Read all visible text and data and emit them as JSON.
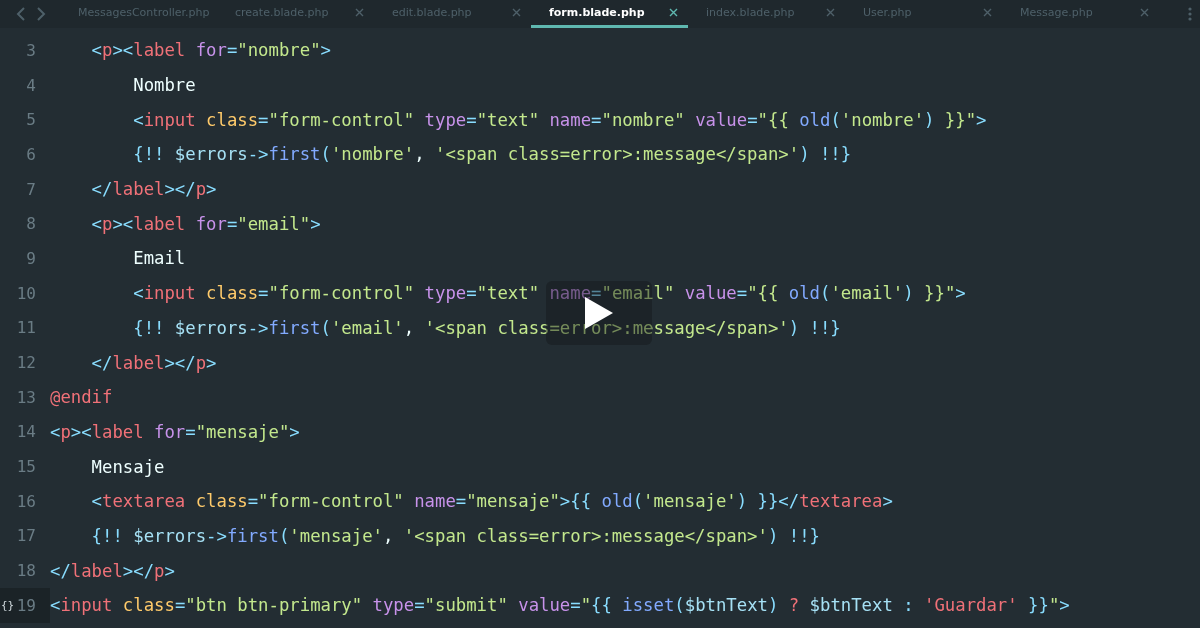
{
  "tabs": [
    {
      "label": "MessagesController.php",
      "selected": false
    },
    {
      "label": "create.blade.php",
      "selected": false
    },
    {
      "label": "edit.blade.php",
      "selected": false
    },
    {
      "label": "form.blade.php",
      "selected": true
    },
    {
      "label": "index.blade.php",
      "selected": false
    },
    {
      "label": "User.php",
      "selected": false
    },
    {
      "label": "Message.php",
      "selected": false
    }
  ],
  "editor": {
    "lines": [
      {
        "number": "3",
        "tokens": [
          {
            "kind": "punct",
            "text": "    <"
          },
          {
            "kind": "tag",
            "text": "p"
          },
          {
            "kind": "punct",
            "text": "><"
          },
          {
            "kind": "tag",
            "text": "label"
          },
          {
            "kind": "attr2",
            "text": " for"
          },
          {
            "kind": "punct",
            "text": "="
          },
          {
            "kind": "str",
            "text": "\"nombre\""
          },
          {
            "kind": "punct",
            "text": ">"
          }
        ]
      },
      {
        "number": "4",
        "tokens": [
          {
            "kind": "txt",
            "text": "        Nombre"
          }
        ]
      },
      {
        "number": "5",
        "tokens": [
          {
            "kind": "punct",
            "text": "        <"
          },
          {
            "kind": "tag",
            "text": "input"
          },
          {
            "kind": "attr",
            "text": " class"
          },
          {
            "kind": "punct",
            "text": "="
          },
          {
            "kind": "str",
            "text": "\"form-control\""
          },
          {
            "kind": "attr2",
            "text": " type"
          },
          {
            "kind": "punct",
            "text": "="
          },
          {
            "kind": "str",
            "text": "\"text\""
          },
          {
            "kind": "attr2",
            "text": " name"
          },
          {
            "kind": "punct",
            "text": "="
          },
          {
            "kind": "str",
            "text": "\"nombre\""
          },
          {
            "kind": "attr2",
            "text": " value"
          },
          {
            "kind": "punct",
            "text": "="
          },
          {
            "kind": "str",
            "text": "\"{{ "
          },
          {
            "kind": "fn",
            "text": "old"
          },
          {
            "kind": "punct",
            "text": "("
          },
          {
            "kind": "str",
            "text": "'nombre'"
          },
          {
            "kind": "punct",
            "text": ")"
          },
          {
            "kind": "str",
            "text": " }}\""
          },
          {
            "kind": "punct",
            "text": ">"
          }
        ]
      },
      {
        "number": "6",
        "tokens": [
          {
            "kind": "punct",
            "text": "        {!!"
          },
          {
            "kind": "var",
            "text": " $errors"
          },
          {
            "kind": "punct",
            "text": "->"
          },
          {
            "kind": "fn",
            "text": "first"
          },
          {
            "kind": "punct",
            "text": "("
          },
          {
            "kind": "str",
            "text": "'nombre'"
          },
          {
            "kind": "txt",
            "text": ", "
          },
          {
            "kind": "str",
            "text": "'<span class=error>:message</span>'"
          },
          {
            "kind": "punct",
            "text": ")"
          },
          {
            "kind": "punct",
            "text": " !!}"
          }
        ]
      },
      {
        "number": "7",
        "tokens": [
          {
            "kind": "punct",
            "text": "    </"
          },
          {
            "kind": "tag",
            "text": "label"
          },
          {
            "kind": "punct",
            "text": "></"
          },
          {
            "kind": "tag",
            "text": "p"
          },
          {
            "kind": "punct",
            "text": ">"
          }
        ]
      },
      {
        "number": "8",
        "tokens": [
          {
            "kind": "punct",
            "text": "    <"
          },
          {
            "kind": "tag",
            "text": "p"
          },
          {
            "kind": "punct",
            "text": "><"
          },
          {
            "kind": "tag",
            "text": "label"
          },
          {
            "kind": "attr2",
            "text": " for"
          },
          {
            "kind": "punct",
            "text": "="
          },
          {
            "kind": "str",
            "text": "\"email\""
          },
          {
            "kind": "punct",
            "text": ">"
          }
        ]
      },
      {
        "number": "9",
        "tokens": [
          {
            "kind": "txt",
            "text": "        Email"
          }
        ]
      },
      {
        "number": "10",
        "tokens": [
          {
            "kind": "punct",
            "text": "        <"
          },
          {
            "kind": "tag",
            "text": "input"
          },
          {
            "kind": "attr",
            "text": " class"
          },
          {
            "kind": "punct",
            "text": "="
          },
          {
            "kind": "str",
            "text": "\"form-control\""
          },
          {
            "kind": "attr2",
            "text": " type"
          },
          {
            "kind": "punct",
            "text": "="
          },
          {
            "kind": "str",
            "text": "\"text\""
          },
          {
            "kind": "attr2",
            "text": " name"
          },
          {
            "kind": "punct",
            "text": "="
          },
          {
            "kind": "str",
            "text": "\"email\""
          },
          {
            "kind": "attr2",
            "text": " value"
          },
          {
            "kind": "punct",
            "text": "="
          },
          {
            "kind": "str",
            "text": "\"{{ "
          },
          {
            "kind": "fn",
            "text": "old"
          },
          {
            "kind": "punct",
            "text": "("
          },
          {
            "kind": "str",
            "text": "'email'"
          },
          {
            "kind": "punct",
            "text": ")"
          },
          {
            "kind": "str",
            "text": " }}\""
          },
          {
            "kind": "punct",
            "text": ">"
          }
        ]
      },
      {
        "number": "11",
        "tokens": [
          {
            "kind": "punct",
            "text": "        {!!"
          },
          {
            "kind": "var",
            "text": " $errors"
          },
          {
            "kind": "punct",
            "text": "->"
          },
          {
            "kind": "fn",
            "text": "first"
          },
          {
            "kind": "punct",
            "text": "("
          },
          {
            "kind": "str",
            "text": "'email'"
          },
          {
            "kind": "txt",
            "text": ", "
          },
          {
            "kind": "str",
            "text": "'<span class=error>:message</span>'"
          },
          {
            "kind": "punct",
            "text": ")"
          },
          {
            "kind": "punct",
            "text": " !!}"
          }
        ]
      },
      {
        "number": "12",
        "tokens": [
          {
            "kind": "punct",
            "text": "    </"
          },
          {
            "kind": "tag",
            "text": "label"
          },
          {
            "kind": "punct",
            "text": "></"
          },
          {
            "kind": "tag",
            "text": "p"
          },
          {
            "kind": "punct",
            "text": ">"
          }
        ]
      },
      {
        "number": "13",
        "tokens": [
          {
            "kind": "dir",
            "text": "@endif"
          }
        ]
      },
      {
        "number": "14",
        "tokens": [
          {
            "kind": "punct",
            "text": "<"
          },
          {
            "kind": "tag",
            "text": "p"
          },
          {
            "kind": "punct",
            "text": "><"
          },
          {
            "kind": "tag",
            "text": "label"
          },
          {
            "kind": "attr2",
            "text": " for"
          },
          {
            "kind": "punct",
            "text": "="
          },
          {
            "kind": "str",
            "text": "\"mensaje\""
          },
          {
            "kind": "punct",
            "text": ">"
          }
        ]
      },
      {
        "number": "15",
        "tokens": [
          {
            "kind": "txt",
            "text": "    Mensaje"
          }
        ]
      },
      {
        "number": "16",
        "tokens": [
          {
            "kind": "punct",
            "text": "    <"
          },
          {
            "kind": "tag",
            "text": "textarea"
          },
          {
            "kind": "attr",
            "text": " class"
          },
          {
            "kind": "punct",
            "text": "="
          },
          {
            "kind": "str",
            "text": "\"form-control\""
          },
          {
            "kind": "attr2",
            "text": " name"
          },
          {
            "kind": "punct",
            "text": "="
          },
          {
            "kind": "str",
            "text": "\"mensaje\""
          },
          {
            "kind": "punct",
            "text": ">{{ "
          },
          {
            "kind": "fn",
            "text": "old"
          },
          {
            "kind": "punct",
            "text": "("
          },
          {
            "kind": "str",
            "text": "'mensaje'"
          },
          {
            "kind": "punct",
            "text": ") }}</"
          },
          {
            "kind": "tag",
            "text": "textarea"
          },
          {
            "kind": "punct",
            "text": ">"
          }
        ]
      },
      {
        "number": "17",
        "tokens": [
          {
            "kind": "punct",
            "text": "    {!!"
          },
          {
            "kind": "var",
            "text": " $errors"
          },
          {
            "kind": "punct",
            "text": "->"
          },
          {
            "kind": "fn",
            "text": "first"
          },
          {
            "kind": "punct",
            "text": "("
          },
          {
            "kind": "str",
            "text": "'mensaje'"
          },
          {
            "kind": "txt",
            "text": ", "
          },
          {
            "kind": "str",
            "text": "'<span class=error>:message</span>'"
          },
          {
            "kind": "punct",
            "text": ")"
          },
          {
            "kind": "punct",
            "text": " !!}"
          }
        ]
      },
      {
        "number": "18",
        "tokens": [
          {
            "kind": "punct",
            "text": "</"
          },
          {
            "kind": "tag",
            "text": "label"
          },
          {
            "kind": "punct",
            "text": "></"
          },
          {
            "kind": "tag",
            "text": "p"
          },
          {
            "kind": "punct",
            "text": ">"
          }
        ]
      },
      {
        "number": "19",
        "marker": "{}",
        "tokens": [
          {
            "kind": "punct",
            "text": "<"
          },
          {
            "kind": "tag",
            "text": "input"
          },
          {
            "kind": "attr",
            "text": " class"
          },
          {
            "kind": "punct",
            "text": "="
          },
          {
            "kind": "str",
            "text": "\"btn btn-primary\""
          },
          {
            "kind": "attr2",
            "text": " type"
          },
          {
            "kind": "punct",
            "text": "="
          },
          {
            "kind": "str",
            "text": "\"submit\""
          },
          {
            "kind": "attr2",
            "text": " value"
          },
          {
            "kind": "punct",
            "text": "="
          },
          {
            "kind": "str",
            "text": "\""
          },
          {
            "kind": "punct",
            "text": "{{ "
          },
          {
            "kind": "fn",
            "text": "isset"
          },
          {
            "kind": "punct",
            "text": "("
          },
          {
            "kind": "var",
            "text": "$btnText"
          },
          {
            "kind": "punct",
            "text": ")"
          },
          {
            "kind": "op",
            "text": " ?"
          },
          {
            "kind": "var",
            "text": " $btnText"
          },
          {
            "kind": "punct",
            "text": " :"
          },
          {
            "kind": "op",
            "text": " 'Guardar'"
          },
          {
            "kind": "punct",
            "text": " }}"
          },
          {
            "kind": "str",
            "text": "\""
          },
          {
            "kind": "punct",
            "text": ">"
          }
        ]
      }
    ]
  }
}
